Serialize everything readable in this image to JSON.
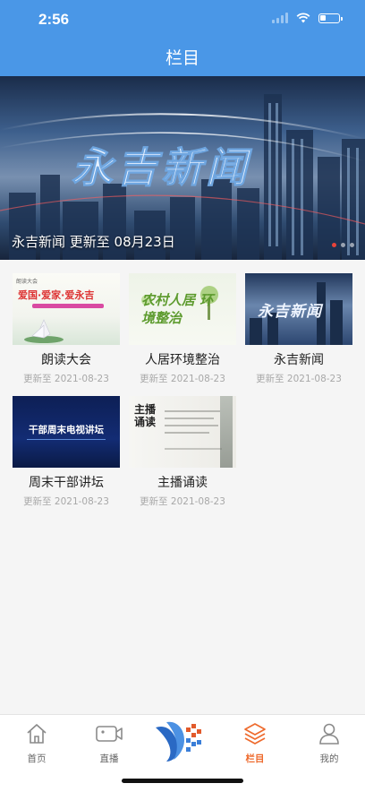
{
  "status": {
    "time": "2:56"
  },
  "header": {
    "title": "栏目"
  },
  "banner": {
    "art_text": "永吉新闻",
    "caption": "永吉新闻 更新至 08月23日",
    "dots": 3,
    "active_dot": 1
  },
  "columns": [
    {
      "title": "朗读大会",
      "updated": "更新至 2021-08-23",
      "thumb_text": "爱国·爱家·爱永吉"
    },
    {
      "title": "人居环境整治",
      "updated": "更新至 2021-08-23",
      "thumb_text": "农村人居 环境整治"
    },
    {
      "title": "永吉新闻",
      "updated": "更新至 2021-08-23",
      "thumb_text": "永吉新闻"
    },
    {
      "title": "周末干部讲坛",
      "updated": "更新至 2021-08-23",
      "thumb_text": "干部周末电视讲坛"
    },
    {
      "title": "主播诵读",
      "updated": "更新至 2021-08-23",
      "thumb_text": "主播诵读"
    }
  ],
  "tabbar": {
    "items": [
      {
        "label": "首页",
        "icon": "home-icon"
      },
      {
        "label": "直播",
        "icon": "video-camera-icon"
      },
      {
        "label": "",
        "icon": "app-logo-icon"
      },
      {
        "label": "栏目",
        "icon": "layers-icon"
      },
      {
        "label": "我的",
        "icon": "person-icon"
      }
    ],
    "active_color": "#ee6a2d"
  },
  "colors": {
    "header": "#4a97e7",
    "accent": "#e8433a"
  }
}
